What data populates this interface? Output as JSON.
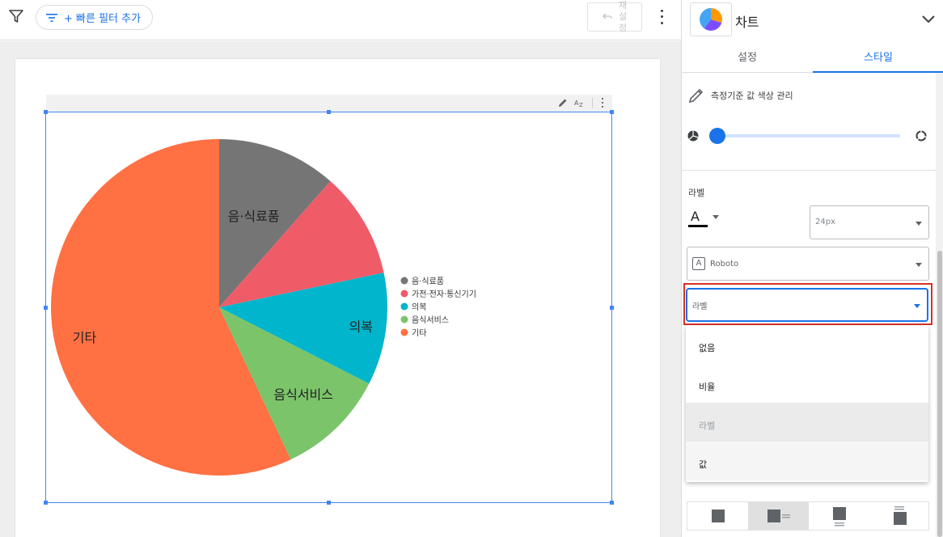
{
  "toolbar": {
    "quick_filter_label": "+ 빠른 필터 추가",
    "reset_chars": [
      "재",
      "설",
      "정"
    ]
  },
  "chart_data": {
    "type": "pie",
    "title": "",
    "slices": [
      {
        "label": "음·식료품",
        "value": 11.5,
        "color": "#757575",
        "inline_label": "음·식료품"
      },
      {
        "label": "가전·전자·통신기기",
        "value": 10.2,
        "color": "#f05b68",
        "inline_label": ""
      },
      {
        "label": "의복",
        "value": 10.8,
        "color": "#00b5cc",
        "inline_label": "의복"
      },
      {
        "label": "음식서비스",
        "value": 10.5,
        "color": "#7cc46a",
        "inline_label": "음식서비스"
      },
      {
        "label": "기타",
        "value": 57.0,
        "color": "#ff7043",
        "inline_label": "기타"
      }
    ],
    "legend_position": "right"
  },
  "panel": {
    "title": "차트",
    "tabs": [
      {
        "label": "설정",
        "active": false
      },
      {
        "label": "스타일",
        "active": true
      }
    ],
    "measure_color_label": "측정기준 값 색상 관리",
    "donut_level": 0.0,
    "section_label": "라벨",
    "font_size": "24px",
    "font_family": "Roboto",
    "label_select_value": "라벨",
    "dropdown_options": [
      {
        "label": "없음",
        "state": "normal"
      },
      {
        "label": "비율",
        "state": "normal"
      },
      {
        "label": "라벨",
        "state": "selected"
      },
      {
        "label": "값",
        "state": "hover"
      }
    ],
    "accent_color": "#1a73e8",
    "highlight_color": "#d93025"
  }
}
